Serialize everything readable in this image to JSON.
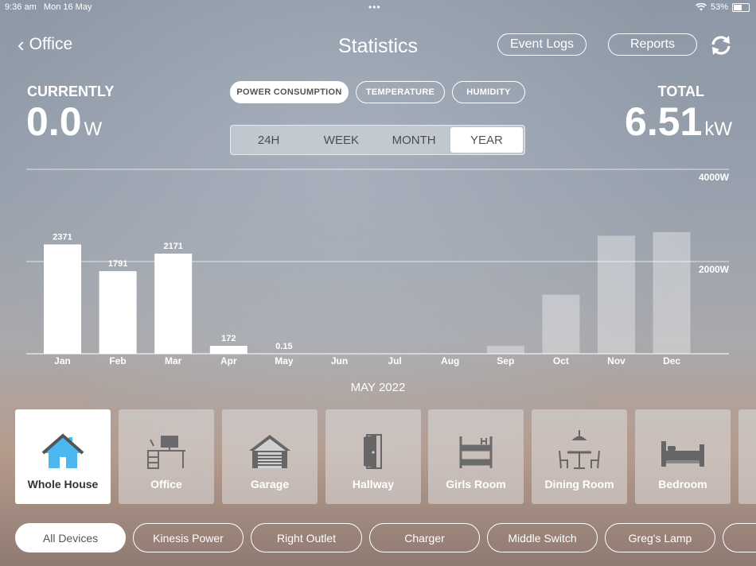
{
  "status_bar": {
    "time": "9:36 am",
    "date": "Mon 16 May",
    "battery": "53%",
    "battery_level": 0.53
  },
  "header": {
    "back_label": "Office",
    "title": "Statistics",
    "event_logs_label": "Event Logs",
    "reports_label": "Reports"
  },
  "currently": {
    "label": "CURRENTLY",
    "value": "0.0",
    "unit": "W"
  },
  "total": {
    "label": "TOTAL",
    "value": "6.51",
    "unit": "kW"
  },
  "metric_tabs": [
    "POWER CONSUMPTION",
    "TEMPERATURE",
    "HUMIDITY"
  ],
  "period_tabs": [
    "24H",
    "WEEK",
    "MONTH",
    "YEAR"
  ],
  "chart_data": {
    "type": "bar",
    "categories": [
      "Jan",
      "Feb",
      "Mar",
      "Apr",
      "May",
      "Jun",
      "Jul",
      "Aug",
      "Sep",
      "Oct",
      "Nov",
      "Dec"
    ],
    "values": [
      2371,
      1791,
      2171,
      172,
      0.15,
      0,
      0,
      0,
      170,
      1280,
      2560,
      2640
    ],
    "highlighted": [
      true,
      true,
      true,
      true,
      true,
      false,
      false,
      false,
      false,
      false,
      false,
      false
    ],
    "data_labels": [
      "2371",
      "1791",
      "2171",
      "172",
      "0.15",
      "",
      "",
      "",
      "",
      "",
      "",
      ""
    ],
    "y_ticks": [
      "4000W",
      "2000W"
    ],
    "ylim": [
      0,
      4000
    ],
    "grid": true
  },
  "selected_month": "MAY 2022",
  "rooms": [
    {
      "name": "Whole House",
      "icon": "house-icon"
    },
    {
      "name": "Office",
      "icon": "desk-icon"
    },
    {
      "name": "Garage",
      "icon": "garage-icon"
    },
    {
      "name": "Hallway",
      "icon": "door-icon"
    },
    {
      "name": "Girls Room",
      "icon": "bunk-bed-icon"
    },
    {
      "name": "Dining Room",
      "icon": "dining-table-icon"
    },
    {
      "name": "Bedroom",
      "icon": "bed-icon"
    }
  ],
  "devices": [
    "All Devices",
    "Kinesis Power",
    "Right Outlet",
    "Charger",
    "Middle Switch",
    "Greg's Lamp"
  ],
  "colors": {
    "accent_house": "#4bb8f0",
    "bar_active": "#ffffff",
    "bar_inactive": "rgba(255,255,255,0.35)"
  }
}
